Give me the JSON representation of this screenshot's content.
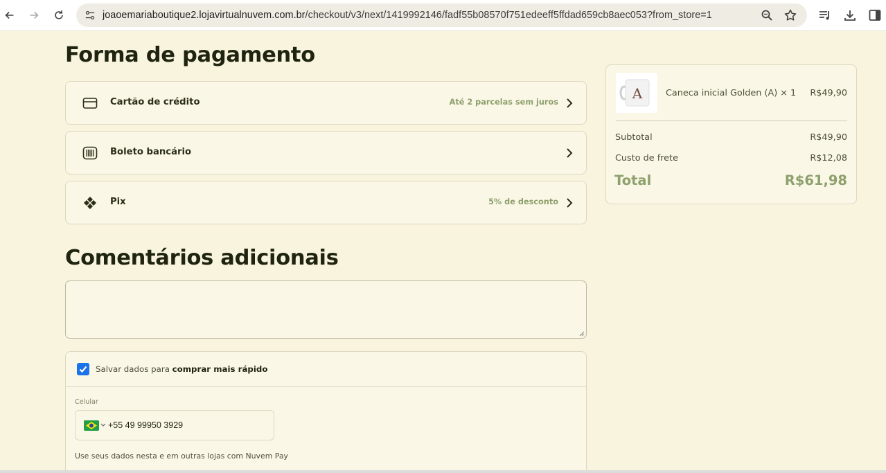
{
  "browser": {
    "url_domain": "joaoemariaboutique2.lojavirtualnuvem.com.br",
    "url_path": "/checkout/v3/next/1419992146/fadf55b08570f751edeeff5ffdad659cb8aec053?from_store=1"
  },
  "payment": {
    "heading": "Forma de pagamento",
    "methods": [
      {
        "label": "Cartão de crédito",
        "note": "Até 2 parcelas sem juros",
        "icon": "credit-card-icon"
      },
      {
        "label": "Boleto bancário",
        "note": "",
        "icon": "barcode-icon"
      },
      {
        "label": "Pix",
        "note": "5% de desconto",
        "icon": "pix-icon"
      }
    ]
  },
  "comments": {
    "heading": "Comentários adicionais",
    "value": ""
  },
  "save_data": {
    "checked": true,
    "text_prefix": "Salvar dados para ",
    "text_bold": "comprar mais rápido",
    "phone_label": "Celular",
    "phone_number": "+55 49 99950 3929",
    "footer_note": "Use seus dados nesta e em outras lojas com Nuvem Pay"
  },
  "summary": {
    "product_name": "Caneca inicial Golden (A) × 1",
    "product_price": "R$49,90",
    "product_thumb_letter": "A",
    "subtotal_label": "Subtotal",
    "subtotal_value": "R$49,90",
    "shipping_label": "Custo de frete",
    "shipping_value": "R$12,08",
    "total_label": "Total",
    "total_value": "R$61,98"
  },
  "colors": {
    "background": "#f9f4de",
    "accent_green": "#8da06d",
    "text_dark": "#1f2410",
    "checkbox_blue": "#1a73e8"
  }
}
